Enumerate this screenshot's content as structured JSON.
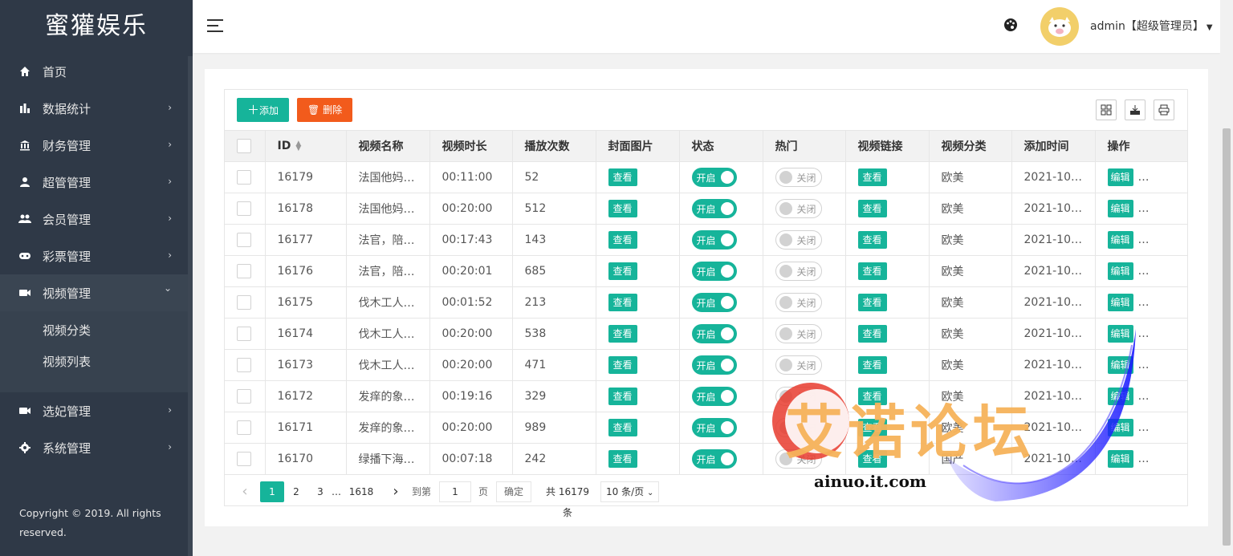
{
  "sidebar": {
    "brand": "蜜獾娱乐",
    "items": [
      {
        "label": "首页",
        "icon": "home-icon",
        "chevron": ""
      },
      {
        "label": "数据统计",
        "icon": "bar-chart-icon",
        "chevron": "›"
      },
      {
        "label": "财务管理",
        "icon": "bank-icon",
        "chevron": "›"
      },
      {
        "label": "超管管理",
        "icon": "user-icon",
        "chevron": "›"
      },
      {
        "label": "会员管理",
        "icon": "users-icon",
        "chevron": "›"
      },
      {
        "label": "彩票管理",
        "icon": "gamepad-icon",
        "chevron": "›"
      },
      {
        "label": "视频管理",
        "icon": "video-icon",
        "chevron": "⌄"
      },
      {
        "label": "选妃管理",
        "icon": "video-icon",
        "chevron": "›"
      },
      {
        "label": "系统管理",
        "icon": "gear-icon",
        "chevron": "›"
      }
    ],
    "submenu": [
      "视频分类",
      "视频列表"
    ],
    "copyright": "Copyright © 2019. All rights reserved."
  },
  "header": {
    "user": "admin【超级管理员】"
  },
  "toolbar": {
    "add_label": "添加",
    "delete_label": "删除"
  },
  "table": {
    "headers": [
      "ID",
      "视频名称",
      "视频时长",
      "播放次数",
      "封面图片",
      "状态",
      "热门",
      "视频链接",
      "视频分类",
      "添加时间",
      "操作"
    ],
    "rows": [
      {
        "id": "16179",
        "name": "法国他妈…",
        "duration": "00:11:00",
        "plays": "52",
        "category": "欧美",
        "time": "2021-10-…"
      },
      {
        "id": "16178",
        "name": "法国他妈…",
        "duration": "00:20:00",
        "plays": "512",
        "category": "欧美",
        "time": "2021-10-…"
      },
      {
        "id": "16177",
        "name": "法官，陪…",
        "duration": "00:17:43",
        "plays": "143",
        "category": "欧美",
        "time": "2021-10-…"
      },
      {
        "id": "16176",
        "name": "法官，陪…",
        "duration": "00:20:01",
        "plays": "685",
        "category": "欧美",
        "time": "2021-10-…"
      },
      {
        "id": "16175",
        "name": "伐木工人…",
        "duration": "00:01:52",
        "plays": "213",
        "category": "欧美",
        "time": "2021-10-…"
      },
      {
        "id": "16174",
        "name": "伐木工人…",
        "duration": "00:20:00",
        "plays": "538",
        "category": "欧美",
        "time": "2021-10-…"
      },
      {
        "id": "16173",
        "name": "伐木工人…",
        "duration": "00:20:00",
        "plays": "471",
        "category": "欧美",
        "time": "2021-10-…"
      },
      {
        "id": "16172",
        "name": "发痒的象…",
        "duration": "00:19:16",
        "plays": "329",
        "category": "欧美",
        "time": "2021-10-…"
      },
      {
        "id": "16171",
        "name": "发痒的象…",
        "duration": "00:20:00",
        "plays": "989",
        "category": "欧美",
        "time": "2021-10-…"
      },
      {
        "id": "16170",
        "name": "绿播下海…",
        "duration": "00:07:18",
        "plays": "242",
        "category": "国产",
        "time": "2021-10-…"
      }
    ],
    "view_label": "查看",
    "on_label": "开启",
    "off_label": "关闭",
    "edit_label": "编辑",
    "more_label": "…"
  },
  "pager": {
    "prev": "‹",
    "pages": [
      "1",
      "2",
      "3"
    ],
    "ellipsis": "…",
    "last": "1618",
    "next": "›",
    "goto_label": "到第",
    "goto_value": "1",
    "page_unit": "页",
    "confirm": "确定",
    "total": "共 16179 条",
    "per_page": "10 条/页"
  },
  "watermark": {
    "text": "艾诺论坛",
    "url": "ainuo.it.com"
  },
  "colors": {
    "accent": "#16b49a",
    "danger": "#f25b1c",
    "sidebar": "#2f3947"
  }
}
